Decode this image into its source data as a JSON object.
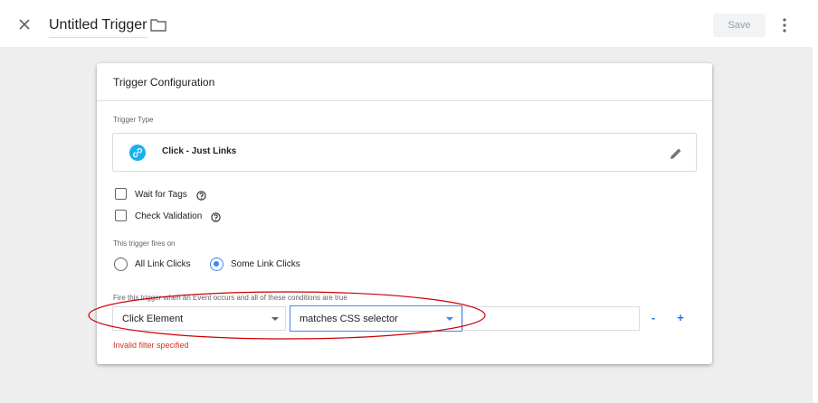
{
  "header": {
    "title": "Untitled Trigger",
    "save_label": "Save",
    "close_icon": "close-icon",
    "folder_icon": "folder-icon",
    "more_icon": "more-vert-icon"
  },
  "card": {
    "title": "Trigger Configuration",
    "trigger_type_label": "Trigger Type",
    "trigger_type_value": "Click - Just Links",
    "trigger_type_icon": "link-icon",
    "options": {
      "wait_for_tags": "Wait for Tags",
      "check_validation": "Check Validation"
    },
    "fires_on_label": "This trigger fires on",
    "radios": {
      "all": "All Link Clicks",
      "some": "Some Link Clicks",
      "selected": "some"
    },
    "conditions_label": "Fire this trigger when an Event occurs and all of these conditions are true",
    "condition": {
      "variable": "Click Element",
      "operator": "matches CSS selector",
      "value": ""
    },
    "minus_label": "-",
    "plus_label": "+",
    "error": "Invalid filter specified"
  },
  "colors": {
    "accent": "#4285f4",
    "error": "#d93025",
    "link_icon_bg": "#1ab0ee",
    "annotation": "#cc0000",
    "canvas_bg": "#eeeeee"
  }
}
